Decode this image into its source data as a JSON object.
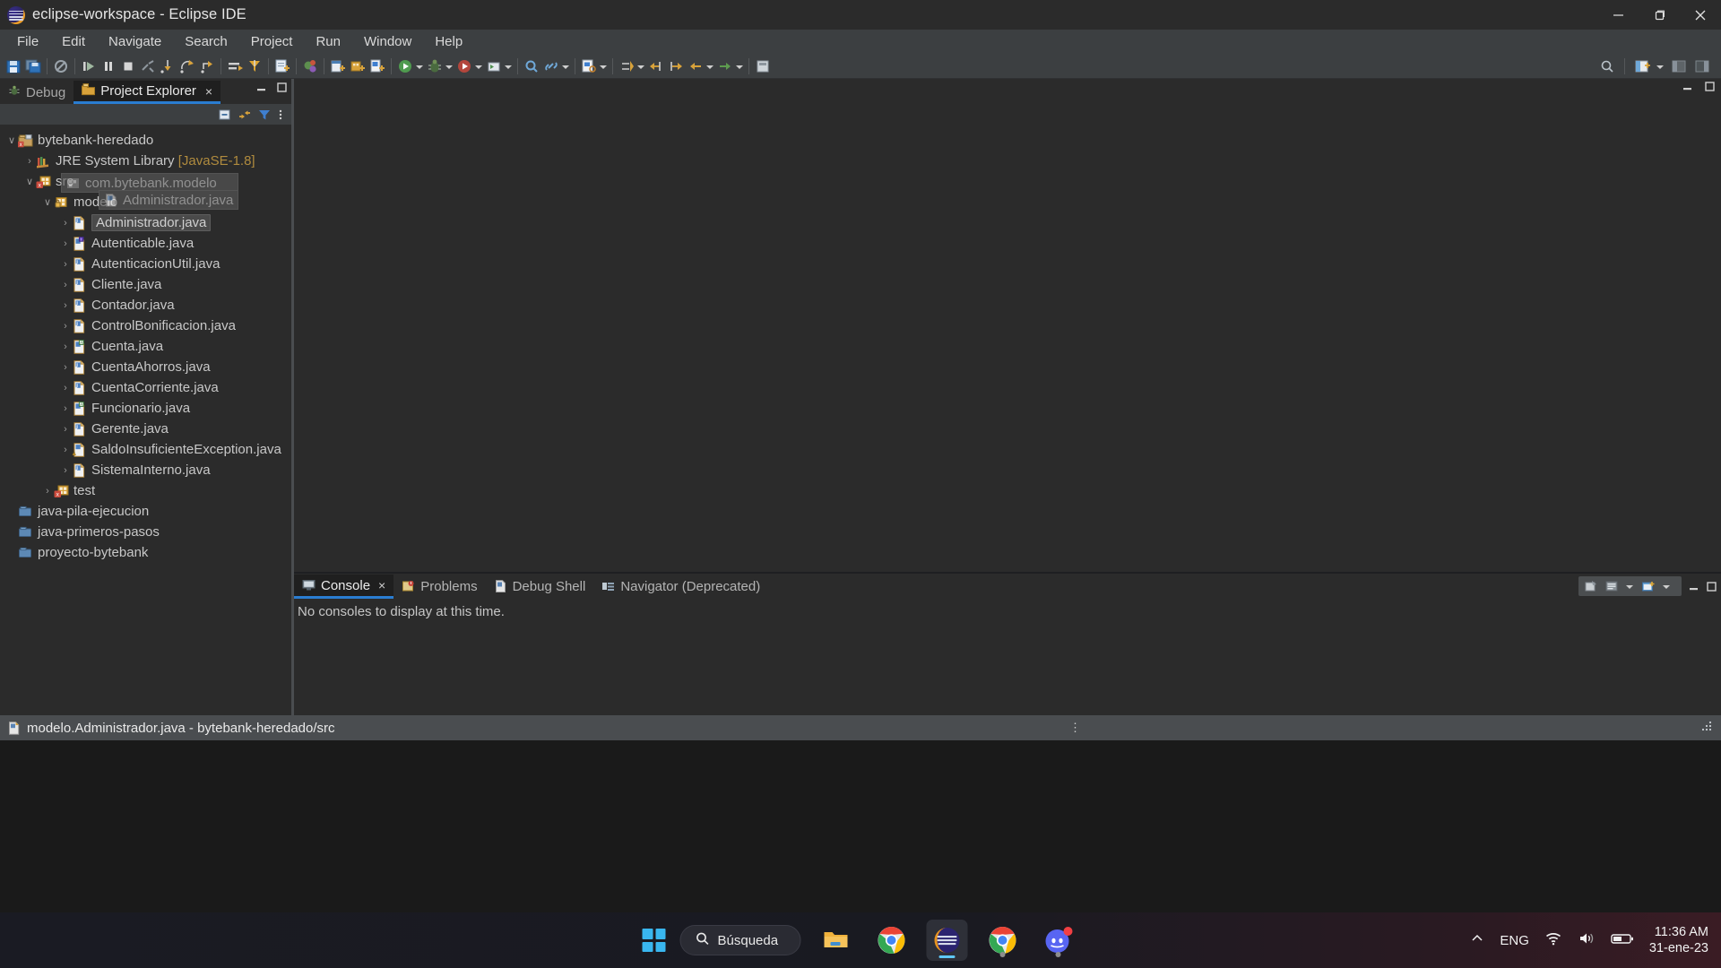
{
  "window": {
    "title": "eclipse-workspace - Eclipse IDE",
    "logo_icon": "eclipse-logo-icon",
    "controls": {
      "minimize": "minimize-icon",
      "maximize": "maximize-icon",
      "close": "close-icon"
    }
  },
  "menubar": {
    "items": [
      "File",
      "Edit",
      "Navigate",
      "Search",
      "Project",
      "Run",
      "Window",
      "Help"
    ]
  },
  "toolbar": {
    "groups": [
      {
        "icons": [
          "save-icon",
          "save-all-icon"
        ]
      },
      {
        "icons": [
          "skip-breakpoints-icon"
        ]
      },
      {
        "icons": [
          "resume-icon",
          "suspend-icon",
          "terminate-icon",
          "disconnect-icon",
          "step-into-icon",
          "step-over-icon",
          "step-return-icon"
        ]
      },
      {
        "icons": [
          "drop-to-frame-icon",
          "use-step-filters-icon"
        ]
      },
      {
        "icons": [
          "new-wizard-icon"
        ]
      },
      {
        "icons": [
          "debug-perspective-icon"
        ]
      },
      {
        "icons": [
          "new-java-project-icon",
          "new-java-package-icon",
          "new-class-icon"
        ]
      },
      {
        "icons": [
          "run-icon",
          "debug-icon",
          "coverage-icon",
          "external-tools-icon"
        ]
      },
      {
        "icons": [
          "search-icon",
          "link-icon"
        ]
      },
      {
        "icons": [
          "open-type-icon"
        ]
      },
      {
        "icons": [
          "previous-annotation-icon",
          "next-annotation-icon",
          "back-icon",
          "forward-icon"
        ]
      },
      {
        "icons": [
          "pin-editor-icon"
        ]
      }
    ],
    "right_icons": [
      "quick-access-search-icon",
      "open-perspective-icon",
      "perspective-switch-icon"
    ]
  },
  "project_explorer": {
    "tabs": [
      {
        "label": "Debug",
        "icon": "debug-view-icon",
        "active": false,
        "closable": false
      },
      {
        "label": "Project Explorer",
        "icon": "project-explorer-icon",
        "active": true,
        "closable": true,
        "close_glyph": "×"
      }
    ],
    "view_minimize": "minimize-view-icon",
    "view_maximize": "maximize-view-icon",
    "view_toolbar_icons": [
      "collapse-all-icon",
      "link-with-editor-icon",
      "view-filter-icon",
      "view-menu-icon"
    ],
    "tree": [
      {
        "depth": 0,
        "arrow": "∨",
        "icon": "java-project-error-icon",
        "label": "bytebank-heredado",
        "suffix": "",
        "selected": false
      },
      {
        "depth": 1,
        "arrow": "›",
        "icon": "jre-library-icon",
        "label": "JRE System Library",
        "suffix": " [JavaSE-1.8]",
        "selected": false
      },
      {
        "depth": 1,
        "arrow": "∨",
        "icon": "source-folder-error-icon",
        "label": "src",
        "suffix": "",
        "selected": false
      },
      {
        "depth": 2,
        "arrow": "∨",
        "icon": "package-lock-icon",
        "label": "modelo",
        "suffix": "",
        "selected": false
      },
      {
        "depth": 3,
        "arrow": "›",
        "icon": "java-class-icon",
        "label": "Administrador.java",
        "suffix": "",
        "selected": true
      },
      {
        "depth": 3,
        "arrow": "›",
        "icon": "java-interface-icon",
        "label": "Autenticable.java",
        "suffix": "",
        "selected": false
      },
      {
        "depth": 3,
        "arrow": "›",
        "icon": "java-class-icon",
        "label": "AutenticacionUtil.java",
        "suffix": "",
        "selected": false
      },
      {
        "depth": 3,
        "arrow": "›",
        "icon": "java-class-icon",
        "label": "Cliente.java",
        "suffix": "",
        "selected": false
      },
      {
        "depth": 3,
        "arrow": "›",
        "icon": "java-class-icon",
        "label": "Contador.java",
        "suffix": "",
        "selected": false
      },
      {
        "depth": 3,
        "arrow": "›",
        "icon": "java-class-icon",
        "label": "ControlBonificacion.java",
        "suffix": "",
        "selected": false
      },
      {
        "depth": 3,
        "arrow": "›",
        "icon": "java-abstract-class-icon",
        "label": "Cuenta.java",
        "suffix": "",
        "selected": false
      },
      {
        "depth": 3,
        "arrow": "›",
        "icon": "java-class-icon",
        "label": "CuentaAhorros.java",
        "suffix": "",
        "selected": false
      },
      {
        "depth": 3,
        "arrow": "›",
        "icon": "java-class-icon",
        "label": "CuentaCorriente.java",
        "suffix": "",
        "selected": false
      },
      {
        "depth": 3,
        "arrow": "›",
        "icon": "java-abstract-class-icon",
        "label": "Funcionario.java",
        "suffix": "",
        "selected": false
      },
      {
        "depth": 3,
        "arrow": "›",
        "icon": "java-class-icon",
        "label": "Gerente.java",
        "suffix": "",
        "selected": false
      },
      {
        "depth": 3,
        "arrow": "›",
        "icon": "java-exception-class-icon",
        "label": "SaldoInsuficienteException.java",
        "suffix": "",
        "selected": false
      },
      {
        "depth": 3,
        "arrow": "›",
        "icon": "java-class-icon",
        "label": "SistemaInterno.java",
        "suffix": "",
        "selected": false
      },
      {
        "depth": 2,
        "arrow": "›",
        "icon": "source-folder-error-icon",
        "label": "test",
        "suffix": "",
        "selected": false
      },
      {
        "depth": 0,
        "arrow": "",
        "icon": "closed-project-icon",
        "label": "java-pila-ejecucion",
        "suffix": "",
        "selected": false
      },
      {
        "depth": 0,
        "arrow": "",
        "icon": "closed-project-icon",
        "label": "java-primeros-pasos",
        "suffix": "",
        "selected": false
      },
      {
        "depth": 0,
        "arrow": "",
        "icon": "closed-project-icon",
        "label": "proyecto-bytebank",
        "suffix": "",
        "selected": false
      }
    ],
    "drag_ghost": {
      "primary": {
        "icon": "package-icon",
        "label": "com.bytebank.modelo"
      },
      "secondary": {
        "icon": "java-class-icon",
        "label": "Administrador.java"
      }
    }
  },
  "editor": {
    "minimize_icon": "minimize-editor-icon",
    "maximize_icon": "maximize-editor-icon"
  },
  "console_panel": {
    "tabs": [
      {
        "label": "Console",
        "icon": "console-icon",
        "active": true,
        "closable": true,
        "close_glyph": "×"
      },
      {
        "label": "Problems",
        "icon": "problems-icon",
        "active": false,
        "closable": false
      },
      {
        "label": "Debug Shell",
        "icon": "debug-shell-icon",
        "active": false,
        "closable": false
      },
      {
        "label": "Navigator (Deprecated)",
        "icon": "navigator-icon",
        "active": false,
        "closable": false
      }
    ],
    "toolbar_icons": [
      "clear-console-icon",
      "scroll-lock-icon",
      "display-selected-console-dropdown-icon",
      "open-console-icon",
      "console-menu-dropdown-icon"
    ],
    "minimize_icon": "minimize-panel-icon",
    "maximize_icon": "maximize-panel-icon",
    "message": "No consoles to display at this time."
  },
  "statusbar": {
    "icon": "java-class-icon",
    "text": "modelo.Administrador.java - bytebank-heredado/src",
    "resize_handle": "resize-grip-icon"
  },
  "taskbar": {
    "start_icon": "windows-start-icon",
    "search": {
      "icon": "search-icon",
      "label": "Búsqueda"
    },
    "apps": [
      {
        "name": "file-explorer-icon",
        "active": false,
        "running": false
      },
      {
        "name": "google-chrome-icon",
        "active": false,
        "running": false
      },
      {
        "name": "eclipse-icon",
        "active": true,
        "running": true
      },
      {
        "name": "google-chrome-icon",
        "active": false,
        "running": true
      },
      {
        "name": "discord-icon",
        "active": false,
        "running": true,
        "badge": true
      }
    ],
    "tray": {
      "chevron_icon": "show-hidden-icons-icon",
      "language": "ENG",
      "wifi_icon": "wifi-icon",
      "volume_icon": "volume-icon",
      "battery_icon": "battery-icon",
      "time": "11:36 AM",
      "date": "31-ene-23"
    }
  },
  "colors": {
    "accent": "#2a7dd1",
    "titlebar_bg": "#2b2b2b",
    "panel_bg": "#2b2b2b",
    "menu_bg": "#3c3f41",
    "status_bg": "#4a4d50",
    "text": "#c8c8c8",
    "java_icon": "#3f7fcf",
    "folder_icon": "#d8a23a"
  }
}
